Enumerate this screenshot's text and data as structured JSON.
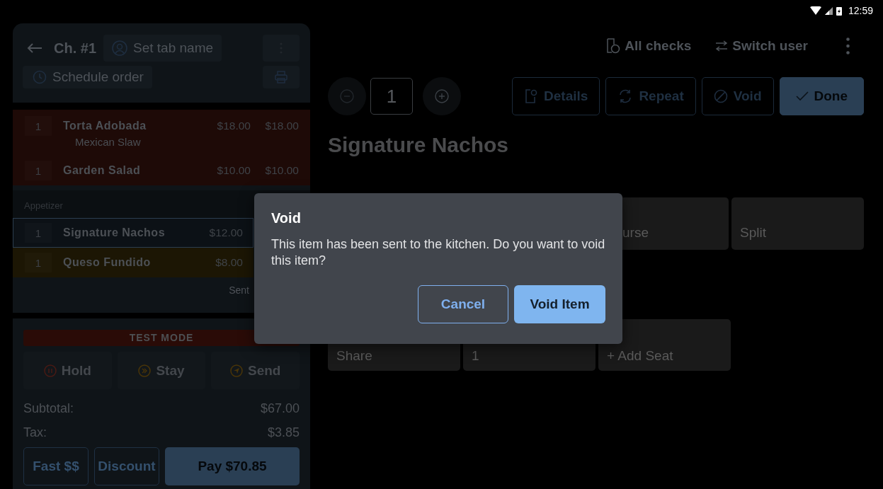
{
  "status_bar": {
    "time": "12:59"
  },
  "check": {
    "title": "Ch. #1",
    "tab_name_button": "Set tab name",
    "schedule_button": "Schedule order"
  },
  "item_groups": [
    {
      "items": [
        {
          "qty": "1",
          "name": "Torta Adobada",
          "modifier": "Mexican Slaw",
          "price": "$18.00",
          "total": "$18.00",
          "color": "#1e0a07",
          "selected": false
        },
        {
          "qty": "1",
          "name": "Garden Salad",
          "price": "$10.00",
          "total": "$10.00",
          "color": "#1e0a07",
          "selected": false
        }
      ]
    },
    {
      "header": "Appetizer",
      "items": [
        {
          "qty": "1",
          "name": "Signature Nachos",
          "price": "$12.00",
          "color": "#0c1116",
          "selected": true
        },
        {
          "qty": "1",
          "name": "Queso Fundido",
          "price": "$8.00",
          "color": "#1c1604",
          "selected": false
        }
      ]
    }
  ],
  "sent_label": "Sent",
  "test_mode_banner": "TEST MODE",
  "order_actions": [
    {
      "label": "Hold",
      "kind": "hold"
    },
    {
      "label": "Stay",
      "kind": "stay"
    },
    {
      "label": "Send",
      "kind": "send"
    }
  ],
  "totals": [
    {
      "label": "Subtotal:",
      "value": "$67.00"
    },
    {
      "label": "Tax:",
      "value": "$3.85"
    }
  ],
  "pay_buttons": [
    {
      "label": "Fast $$",
      "kind": "outline"
    },
    {
      "label": "Discount",
      "kind": "outline"
    },
    {
      "label": "Pay $70.85",
      "kind": "filled"
    }
  ],
  "top_actions": [
    {
      "label": "All checks",
      "kind": "checks"
    },
    {
      "label": "Switch user",
      "kind": "switch"
    }
  ],
  "quantity": "1",
  "item_actions": [
    {
      "label": "Details",
      "kind": "details"
    },
    {
      "label": "Repeat",
      "kind": "repeat"
    },
    {
      "label": "Void",
      "kind": "void"
    },
    {
      "label": "Done",
      "kind": "done"
    }
  ],
  "item_title": "Signature Nachos",
  "option_rows": [
    [
      "urse",
      "Split"
    ],
    [
      "Share",
      "1",
      "+ Add Seat"
    ]
  ],
  "dialog": {
    "title": "Void",
    "message": "This item has been sent to the kitchen. Do you want to void this item?",
    "buttons": [
      {
        "label": "Cancel",
        "kind": "outline"
      },
      {
        "label": "Void Item",
        "kind": "filled"
      }
    ]
  }
}
